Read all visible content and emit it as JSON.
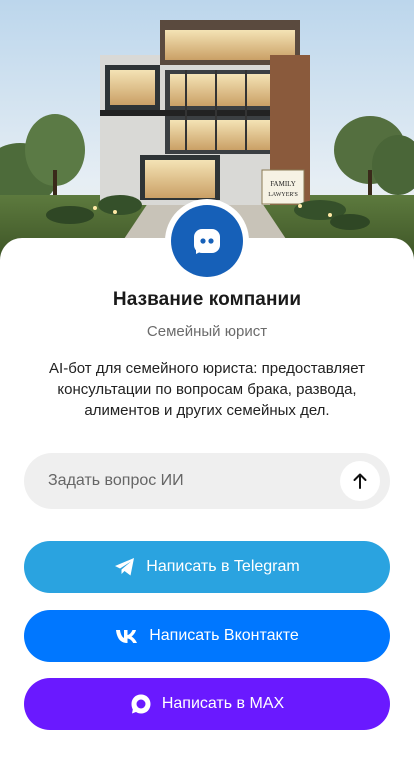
{
  "hero": {
    "sign_line1": "FAMILY",
    "sign_line2": "LAWYER'S"
  },
  "profile": {
    "name": "Название компании",
    "role": "Семейный юрист",
    "description": "AI-бот для семейного юриста: предоставляет консультации по вопросам брака, развода, алиментов и других семейных дел.",
    "avatar_icon": "chat-bubble-icon"
  },
  "ask": {
    "placeholder": "Задать вопрос ИИ",
    "send_icon": "arrow-up-icon"
  },
  "actions": [
    {
      "label": "Написать в Telegram",
      "icon": "telegram-icon",
      "color": "#2aa3e0"
    },
    {
      "label": "Написать Вконтакте",
      "icon": "vk-icon",
      "color": "#0077ff"
    },
    {
      "label": "Написать в MAX",
      "icon": "max-icon",
      "color": "#6a19ff"
    }
  ],
  "colors": {
    "avatar": "#1660b8",
    "input_bg": "#efefef"
  }
}
